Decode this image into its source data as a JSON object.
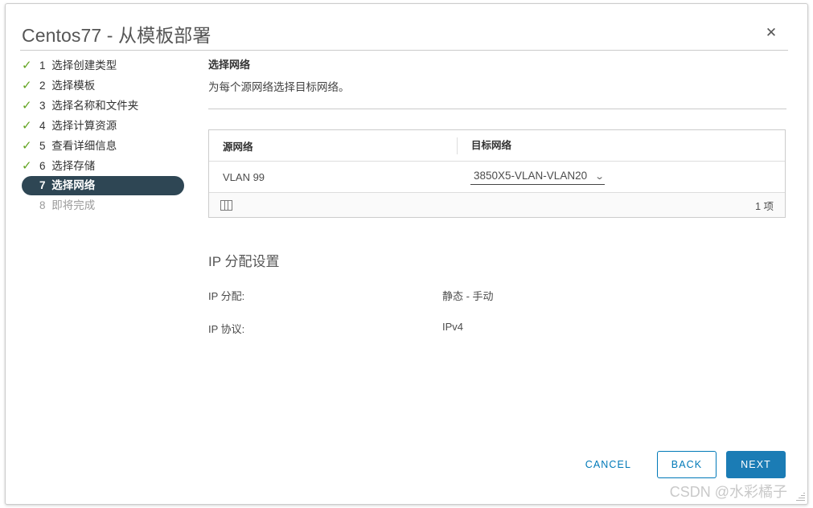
{
  "window": {
    "title": "Centos77 - 从模板部署",
    "close_icon": "close-icon"
  },
  "steps": [
    {
      "num": "1",
      "label": "选择创建类型",
      "state": "done"
    },
    {
      "num": "2",
      "label": "选择模板",
      "state": "done"
    },
    {
      "num": "3",
      "label": "选择名称和文件夹",
      "state": "done"
    },
    {
      "num": "4",
      "label": "选择计算资源",
      "state": "done"
    },
    {
      "num": "5",
      "label": "查看详细信息",
      "state": "done"
    },
    {
      "num": "6",
      "label": "选择存储",
      "state": "done"
    },
    {
      "num": "7",
      "label": "选择网络",
      "state": "active"
    },
    {
      "num": "8",
      "label": "即将完成",
      "state": "pending"
    }
  ],
  "content": {
    "heading": "选择网络",
    "subheading": "为每个源网络选择目标网络。"
  },
  "network_table": {
    "columns": [
      "源网络",
      "目标网络"
    ],
    "rows": [
      {
        "source": "VLAN 99",
        "destination": "3850X5-VLAN-VLAN20"
      }
    ],
    "caret_icon": "chevron-down-icon",
    "columns_icon": "columns-toggle-icon",
    "row_count_label": "1 项"
  },
  "ip_settings": {
    "title": "IP 分配设置",
    "fields": [
      {
        "label": "IP 分配:",
        "value": "静态 - 手动"
      },
      {
        "label": "IP 协议:",
        "value": "IPv4"
      }
    ]
  },
  "footer": {
    "cancel_label": "CANCEL",
    "back_label": "BACK",
    "next_label": "NEXT"
  },
  "watermark": {
    "text": "CSDN @水彩橘子"
  },
  "colors": {
    "accent_blue": "#0079b8",
    "primary_button": "#1b7cb5",
    "active_step_bg": "#2e4654",
    "check_green": "#62a420"
  }
}
